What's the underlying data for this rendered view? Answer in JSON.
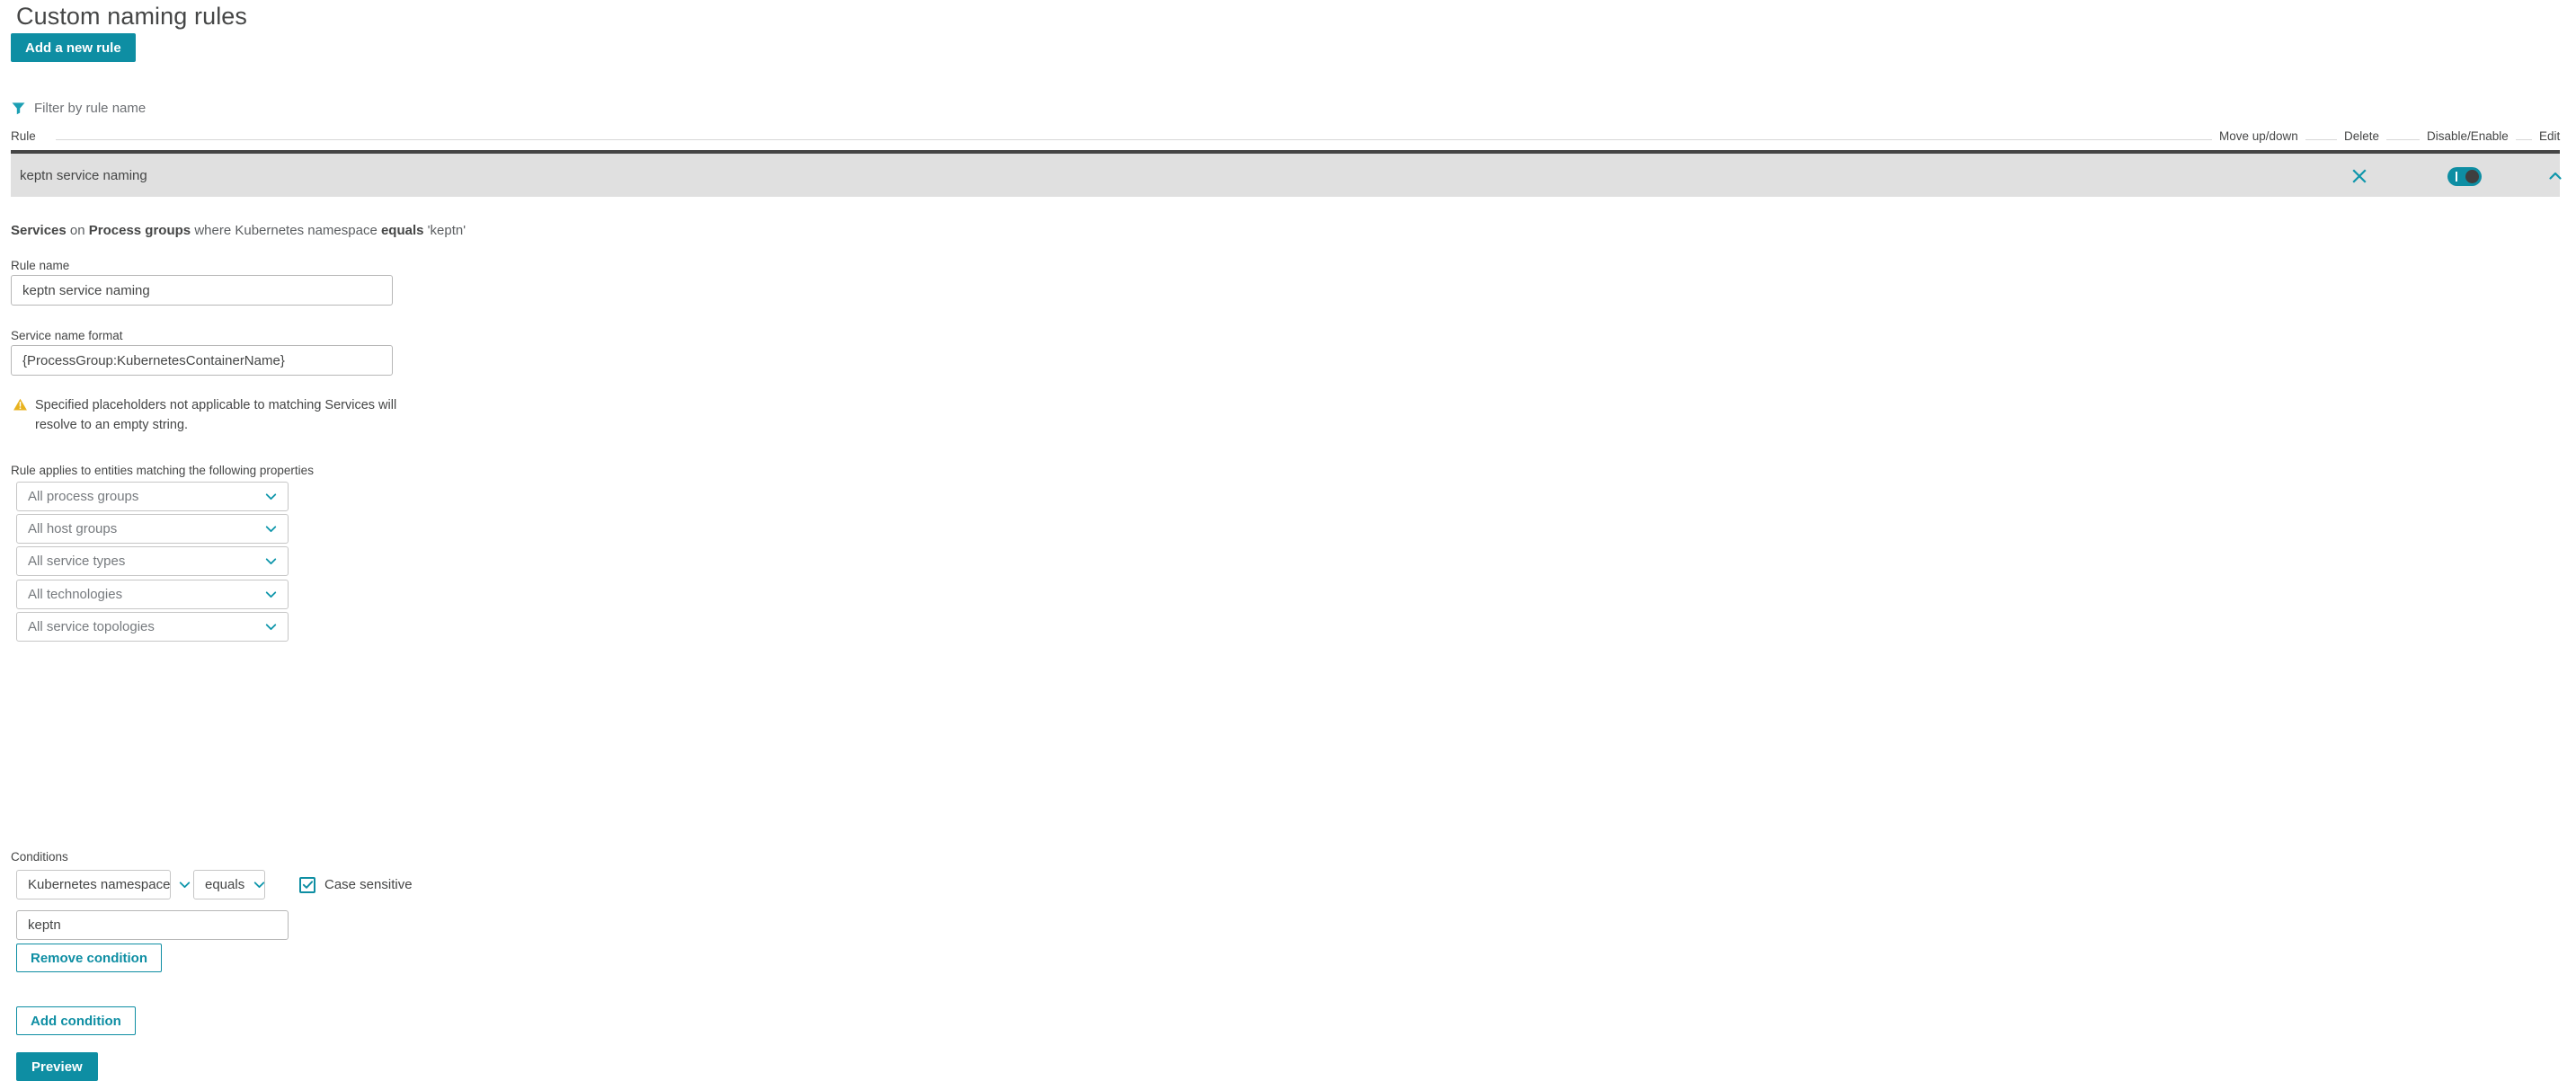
{
  "page": {
    "title": "Custom naming rules",
    "add_rule_label": "Add a new rule"
  },
  "filter": {
    "icon": "filter-icon",
    "placeholder": "Filter by rule name",
    "value": ""
  },
  "table": {
    "columns": {
      "rule": "Rule",
      "move": "Move up/down",
      "delete": "Delete",
      "disable": "Disable/Enable",
      "edit": "Edit"
    },
    "rows": [
      {
        "name": "keptn service naming",
        "delete_icon": "close-icon",
        "toggle_state": "on",
        "edit_icon": "chevron-up-icon"
      }
    ]
  },
  "detail": {
    "summary": {
      "entity": "Services",
      "on": "on",
      "source": "Process groups",
      "where": "where",
      "condition_key": "Kubernetes namespace",
      "operator": "equals",
      "condition_value": "'keptn'"
    },
    "rule_name": {
      "label": "Rule name",
      "value": "keptn service naming"
    },
    "service_name_format": {
      "label": "Service name format",
      "value": "{ProcessGroup:KubernetesContainerName}"
    },
    "warning": {
      "icon": "warning-triangle-icon",
      "text": "Specified placeholders not applicable to matching Services will resolve to an empty string.",
      "color": "#e6a817"
    },
    "properties": {
      "label": "Rule applies to entities matching the following properties",
      "selects": [
        {
          "value": "All process groups",
          "icon": "chevron-down-icon"
        },
        {
          "value": "All host groups",
          "icon": "chevron-down-icon"
        },
        {
          "value": "All service types",
          "icon": "chevron-down-icon"
        },
        {
          "value": "All technologies",
          "icon": "chevron-down-icon"
        },
        {
          "value": "All service topologies",
          "icon": "chevron-down-icon"
        }
      ]
    },
    "conditions": {
      "label": "Conditions",
      "key_select": "Kubernetes namespace",
      "operator_select": "equals",
      "case_sensitive_label": "Case sensitive",
      "case_sensitive_checked": true,
      "value": "keptn",
      "remove_label": "Remove condition",
      "add_label": "Add condition"
    },
    "preview_label": "Preview"
  },
  "colors": {
    "accent": "#0e8ea3",
    "row_background": "#e0e0e0",
    "row_border": "#454545",
    "warning": "#e6a817",
    "text": "#454646"
  }
}
